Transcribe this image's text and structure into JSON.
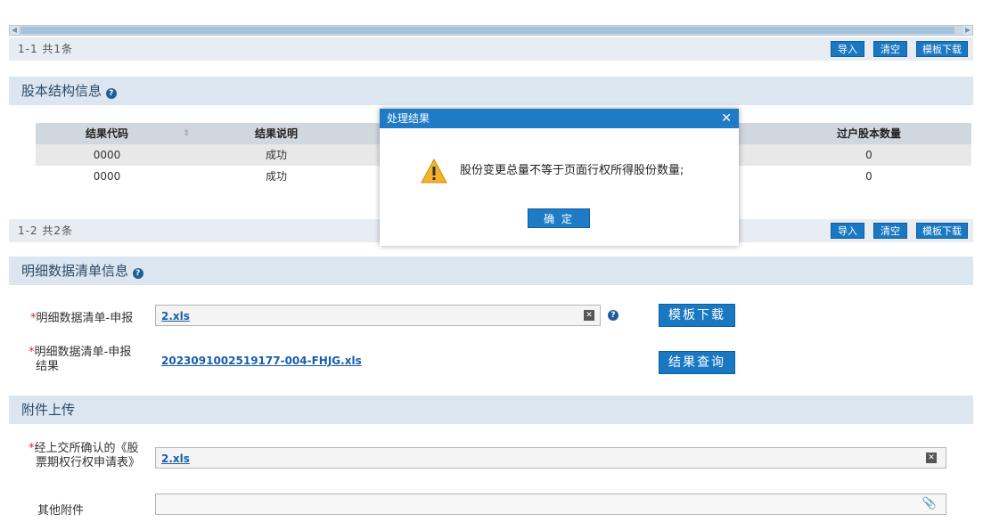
{
  "top_pager": {
    "text": "1-1  共1条",
    "buttons": [
      "导入",
      "清空",
      "模板下载"
    ]
  },
  "equity_section": {
    "title": "股本结构信息",
    "help_icon": "question-circle-icon",
    "columns": [
      "结果代码",
      "结果说明",
      "过户股本数量"
    ],
    "rows": [
      {
        "code": "0000",
        "desc": "成功",
        "qty": "0"
      },
      {
        "code": "0000",
        "desc": "成功",
        "qty": "0"
      }
    ],
    "pager_text": "1-2  共2条",
    "buttons": [
      "导入",
      "清空",
      "模板下载"
    ]
  },
  "detail_section": {
    "title": "明细数据清单信息",
    "help_icon": "question-circle-icon",
    "field1_label": "明细数据清单-申报",
    "field1_file": "2.xls",
    "field1_button": "模板下载",
    "field2_label_line1": "明细数据清单-申报",
    "field2_label_line2": "结果",
    "field2_file": "2023091002519177-004-FHJG.xls",
    "field2_button": "结果查询"
  },
  "attach_section": {
    "title": "附件上传",
    "field1_label_line1": "经上交所确认的《股",
    "field1_label_line2": "票期权行权申请表》",
    "field1_file": "2.xls",
    "field2_label": "其他附件"
  },
  "modal": {
    "title": "处理结果",
    "close": "✕",
    "icon": "warning-icon",
    "message": "股份变更总量不等于页面行权所得股份数量;",
    "ok": "确 定"
  },
  "colors": {
    "accent": "#1f7bc6",
    "section_bg": "#dbe6f0",
    "required": "#d92b2b"
  }
}
